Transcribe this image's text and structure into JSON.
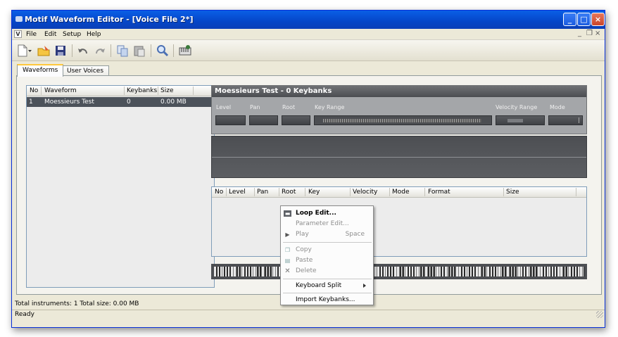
{
  "window": {
    "title": "Motif Waveform Editor - [Voice File 2*]",
    "controls": [
      "minimize",
      "maximize",
      "close"
    ]
  },
  "menu": {
    "app_icon": "V",
    "items": [
      "File",
      "Edit",
      "Setup",
      "Help"
    ],
    "mdi_controls": [
      "_",
      "×"
    ]
  },
  "toolbar": {
    "buttons": [
      "new-icon",
      "open-icon",
      "save-icon",
      "undo-icon",
      "redo-icon",
      "copy-icon",
      "paste-icon",
      "search-icon",
      "keyboard-icon"
    ]
  },
  "tabs": [
    {
      "label": "Waveforms",
      "active": true
    },
    {
      "label": "User Voices",
      "active": false
    }
  ],
  "waveform_list": {
    "columns": [
      "No",
      "Waveform",
      "Keybanks",
      "Size"
    ],
    "rows": [
      {
        "no": "1",
        "waveform": "Moessieurs Test",
        "keybanks": "0",
        "size": "0.00 MB",
        "selected": true
      }
    ]
  },
  "detail": {
    "title": "Moessieurs Test - 0 Keybanks",
    "params": [
      "Level",
      "Pan",
      "Root",
      "Key Range",
      "Velocity Range",
      "Mode"
    ]
  },
  "keybank_table": {
    "columns": [
      "No",
      "Level",
      "Pan",
      "Root",
      "Key",
      "Velocity",
      "Mode",
      "Format",
      "Size"
    ]
  },
  "context_menu": {
    "items": [
      {
        "label": "Loop Edit...",
        "icon": "loop-edit-icon",
        "enabled": true,
        "bold": true
      },
      {
        "label": "Parameter Edit...",
        "enabled": false
      },
      {
        "label": "Play",
        "icon": "play-icon",
        "shortcut": "Space",
        "enabled": false
      },
      {
        "label": "Copy",
        "icon": "copy-icon",
        "enabled": false
      },
      {
        "label": "Paste",
        "icon": "paste-icon",
        "enabled": false
      },
      {
        "label": "Delete",
        "icon": "delete-icon",
        "enabled": false
      },
      {
        "label": "Keyboard Split",
        "submenu": true,
        "enabled": true
      },
      {
        "label": "Import Keybanks...",
        "enabled": true
      }
    ]
  },
  "status": {
    "totals": "Total instruments: 1   Total size: 0.00 MB",
    "state": "Ready"
  }
}
